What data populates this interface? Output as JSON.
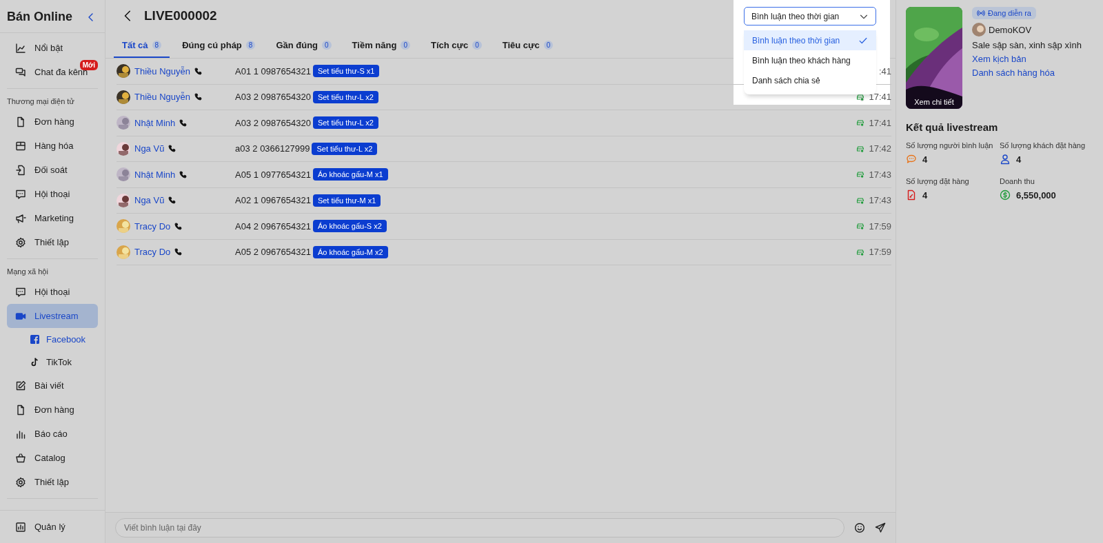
{
  "sidebar": {
    "title": "Bán Online",
    "sections": [
      {
        "items": [
          {
            "label": "Nổi bật",
            "selected": false
          },
          {
            "label": "Chat đa kênh",
            "selected": false,
            "badge": "Mới"
          }
        ]
      },
      {
        "heading": "Thương mại điện tử",
        "items": [
          {
            "label": "Đơn hàng",
            "selected": false
          },
          {
            "label": "Hàng hóa",
            "selected": false
          },
          {
            "label": "Đối soát",
            "selected": false
          },
          {
            "label": "Hội thoại",
            "selected": false
          },
          {
            "label": "Marketing",
            "selected": false
          },
          {
            "label": "Thiết lập",
            "selected": false
          }
        ]
      },
      {
        "heading": "Mạng xã hội",
        "items": [
          {
            "label": "Hội thoại",
            "selected": false
          },
          {
            "label": "Livestream",
            "selected": true,
            "children": [
              {
                "label": "Facebook",
                "selected": true
              },
              {
                "label": "TikTok",
                "selected": false
              }
            ]
          },
          {
            "label": "Bài viết",
            "selected": false
          },
          {
            "label": "Đơn hàng",
            "selected": false
          },
          {
            "label": "Báo cáo",
            "selected": false
          },
          {
            "label": "Catalog",
            "selected": false
          },
          {
            "label": "Thiết lập",
            "selected": false
          }
        ]
      }
    ],
    "footer_item": {
      "label": "Quản lý",
      "selected": false
    }
  },
  "header": {
    "title": "LIVE000002"
  },
  "tabs": [
    {
      "label": "Tất cả",
      "count": "8",
      "selected": true
    },
    {
      "label": "Đúng cú pháp",
      "count": "8",
      "selected": false
    },
    {
      "label": "Gần đúng",
      "count": "0",
      "selected": false
    },
    {
      "label": "Tiềm năng",
      "count": "0",
      "selected": false
    },
    {
      "label": "Tích cực",
      "count": "0",
      "selected": false
    },
    {
      "label": "Tiêu cực",
      "count": "0",
      "selected": false
    }
  ],
  "sort_select": {
    "value": "Bình luận theo thời gian",
    "expanded": true,
    "options": [
      {
        "label": "Bình luận theo thời gian",
        "selected": true
      },
      {
        "label": "Bình luận theo khách hàng",
        "selected": false
      },
      {
        "label": "Danh sách chia sẻ",
        "selected": false
      }
    ]
  },
  "comments": [
    {
      "name": "Thiều Nguyễn",
      "text": "A01 1 0987654321",
      "tag": "Set tiểu thư-S x1",
      "time": ":41",
      "ordered": false
    },
    {
      "name": "Thiều Nguyễn",
      "text": "A03 2 0987654320",
      "tag": "Set tiểu thư-L x2",
      "time": "17:41",
      "ordered": true
    },
    {
      "name": "Nhật Minh",
      "text": "A03 2 0987654320",
      "tag": "Set tiểu thư-L x2",
      "time": "17:41",
      "ordered": true
    },
    {
      "name": "Nga Vũ",
      "text": "a03 2 0366127999",
      "tag": "Set tiểu thư-L x2",
      "time": "17:42",
      "ordered": true
    },
    {
      "name": "Nhật Minh",
      "text": "A05 1 0977654321",
      "tag": "Áo khoác gấu-M x1",
      "time": "17:43",
      "ordered": true
    },
    {
      "name": "Nga Vũ",
      "text": "A02 1 0967654321",
      "tag": "Set tiểu thư-M x1",
      "time": "17:43",
      "ordered": true
    },
    {
      "name": "Tracy Do",
      "text": "A04 2 0967654321",
      "tag": "Áo khoác gấu-S x2",
      "time": "17:59",
      "ordered": true
    },
    {
      "name": "Tracy Do",
      "text": "A05 2 0967654321",
      "tag": "Áo khoác gấu-M x2",
      "time": "17:59",
      "ordered": true
    }
  ],
  "composer": {
    "placeholder": "Viết bình luận tại đây"
  },
  "live": {
    "thumbnail_caption": "Xem chi tiết",
    "status": "Đang diễn ra",
    "host": "DemoKOV",
    "title": "Sale sập sàn, xinh sập xình",
    "links": [
      "Xem kịch bản",
      "Danh sách hàng hóa"
    ]
  },
  "results": {
    "title": "Kết quả livestream",
    "stats": [
      {
        "kind": "comments",
        "label": "Số lượng người bình luận",
        "value": "4"
      },
      {
        "kind": "customers",
        "label": "Số lượng khách đặt hàng",
        "value": "4"
      },
      {
        "kind": "orders",
        "label": "Số lượng đặt hàng",
        "value": "4"
      },
      {
        "kind": "revenue",
        "label": "Doanh thu",
        "value": "6,550,000"
      }
    ]
  }
}
